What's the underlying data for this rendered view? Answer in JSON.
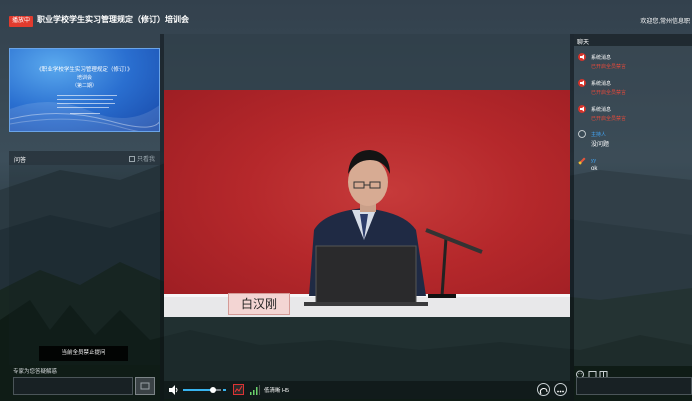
{
  "header": {
    "live_badge": "播放中",
    "title": "职业学校学生实习管理规定（修订）培训会",
    "welcome": "欢迎您,常州信息职"
  },
  "slide": {
    "title": "《职业学校学生实习管理规定（修订）》",
    "subtitle_line2": "培训会",
    "subtitle_line3": "（第二期）"
  },
  "qa": {
    "title": "问答",
    "only_mine_label": "只看我",
    "disabled_notice": "当前全员禁止提问",
    "hint": "专家为您答疑解惑",
    "send_icon": "send-icon"
  },
  "video": {
    "speaker_name_card": "白汉刚"
  },
  "controls": {
    "volume_level": 0.8,
    "quality_label": "低清晰 H5",
    "accent_color": "#38b4f0"
  },
  "chat": {
    "title": "聊天",
    "messages": [
      {
        "sender": "系统消息",
        "text": "已开启全员禁言",
        "kind": "system"
      },
      {
        "sender": "系统消息",
        "text": "已开启全员禁言",
        "kind": "system"
      },
      {
        "sender": "系统消息",
        "text": "已开启全员禁言",
        "kind": "system"
      },
      {
        "sender": "主持人",
        "text": "没问题",
        "kind": "host"
      },
      {
        "sender": "yy",
        "text": "ok",
        "kind": "user"
      }
    ]
  }
}
